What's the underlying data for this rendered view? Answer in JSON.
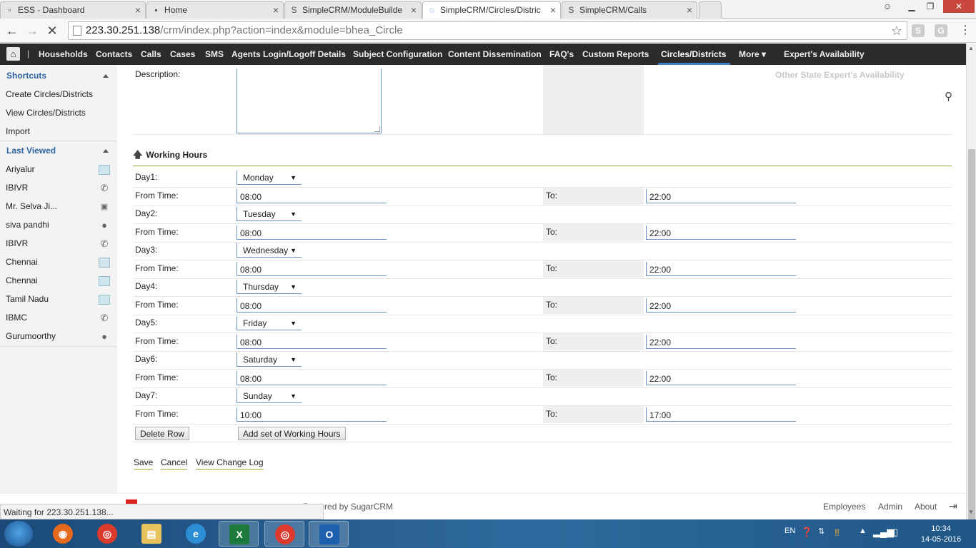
{
  "browser": {
    "tabs": [
      {
        "title": "ESS - Dashboard",
        "icon": "page-icon"
      },
      {
        "title": "Home",
        "icon": "page-icon"
      },
      {
        "title": "SimpleCRM/ModuleBuilde",
        "icon": "simplecrm-icon"
      },
      {
        "title": "SimpleCRM/Circles/Distric",
        "icon": "loading-icon",
        "active": true
      },
      {
        "title": "SimpleCRM/Calls",
        "icon": "simplecrm-icon"
      }
    ],
    "url_host": "223.30.251.138",
    "url_path": "/crm/index.php?action=index&module=bhea_Circle"
  },
  "crm_nav": {
    "items": [
      "Households",
      "Contacts",
      "Calls",
      "Cases",
      "SMS",
      "Agents Login/Logoff Details",
      "Subject Configuration",
      "Content Dissemination",
      "FAQ's",
      "Custom Reports",
      "Circles/Districts",
      "More",
      "Expert's Availability"
    ],
    "current": "Circles/Districts",
    "separator": "|"
  },
  "sidebar": {
    "shortcuts_title": "Shortcuts",
    "shortcuts": [
      "Create Circles/Districts",
      "View Circles/Districts",
      "Import"
    ],
    "last_viewed_title": "Last Viewed",
    "last_viewed": [
      {
        "label": "Ariyalur",
        "icon": "record-icon"
      },
      {
        "label": "IBIVR",
        "icon": "phone-icon"
      },
      {
        "label": "Mr. Selva Ji...",
        "icon": "contact-card-icon"
      },
      {
        "label": "siva pandhi",
        "icon": "person-icon"
      },
      {
        "label": "IBIVR",
        "icon": "phone-icon"
      },
      {
        "label": "Chennai",
        "icon": "record-icon"
      },
      {
        "label": "Chennai",
        "icon": "record-icon"
      },
      {
        "label": "Tamil Nadu",
        "icon": "record-icon"
      },
      {
        "label": "IBMC",
        "icon": "phone-icon"
      },
      {
        "label": "Gurumoorthy",
        "icon": "person-icon"
      }
    ]
  },
  "form": {
    "description_label": "Description:",
    "other_state_label": "Other State Expert's Availability",
    "section_title": "Working Hours",
    "from_label": "From Time:",
    "to_label": "To:",
    "days": [
      {
        "label": "Day1:",
        "day": "Monday",
        "from": "08:00",
        "to": "22:00"
      },
      {
        "label": "Day2:",
        "day": "Tuesday",
        "from": "08:00",
        "to": "22:00"
      },
      {
        "label": "Day3:",
        "day": "Wednesday",
        "from": "08:00",
        "to": "22:00"
      },
      {
        "label": "Day4:",
        "day": "Thursday",
        "from": "08:00",
        "to": "22:00"
      },
      {
        "label": "Day5:",
        "day": "Friday",
        "from": "08:00",
        "to": "22:00"
      },
      {
        "label": "Day6:",
        "day": "Saturday",
        "from": "08:00",
        "to": "22:00"
      },
      {
        "label": "Day7:",
        "day": "Sunday",
        "from": "10:00",
        "to": "17:00"
      }
    ],
    "delete_row": "Delete Row",
    "add_set": "Add set of Working Hours",
    "actions": [
      "Save",
      "Cancel",
      "View Change Log"
    ]
  },
  "footer": {
    "status": "Waiting for 223.30.251.138...",
    "powered": "Powered by SugarCRM",
    "links": [
      "Employees",
      "Admin",
      "About"
    ]
  },
  "taskbar": {
    "lang": "EN",
    "time": "10:34",
    "date": "14-05-2016"
  }
}
